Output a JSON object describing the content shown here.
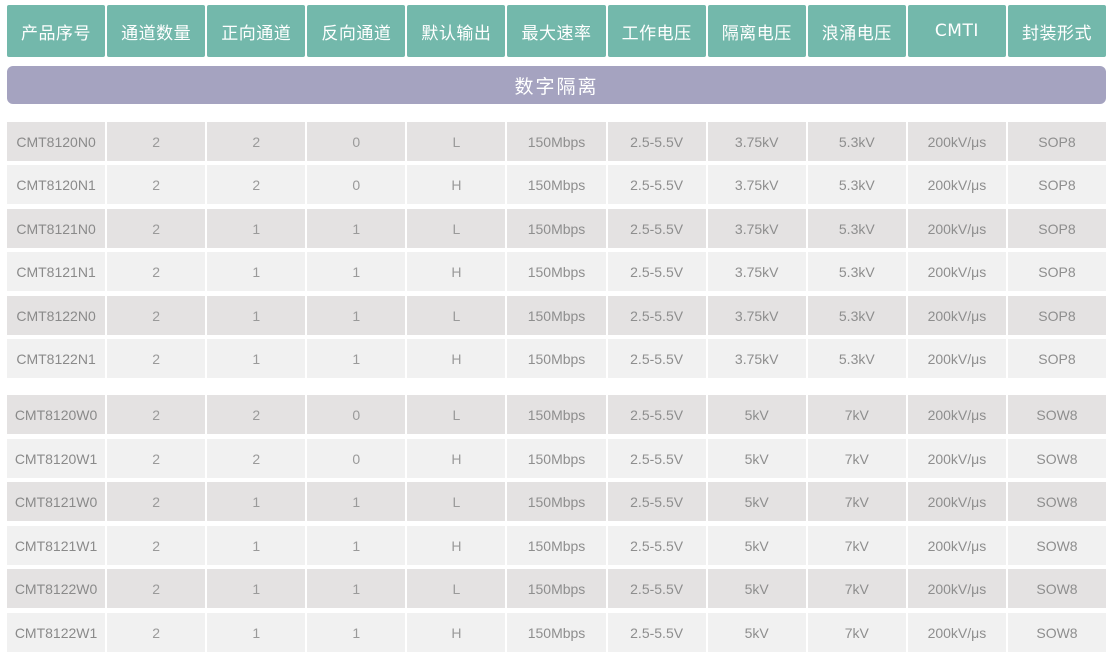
{
  "table": {
    "headers": [
      "产品序号",
      "通道数量",
      "正向通道",
      "反向通道",
      "默认输出",
      "最大速率",
      "工作电压",
      "隔离电压",
      "浪涌电压",
      "CMTI",
      "封装形式"
    ],
    "section_title": "数字隔离",
    "rows": [
      [
        "CMT8120N0",
        "2",
        "2",
        "0",
        "L",
        "150Mbps",
        "2.5-5.5V",
        "3.75kV",
        "5.3kV",
        "200kV/μs",
        "SOP8"
      ],
      [
        "CMT8120N1",
        "2",
        "2",
        "0",
        "H",
        "150Mbps",
        "2.5-5.5V",
        "3.75kV",
        "5.3kV",
        "200kV/μs",
        "SOP8"
      ],
      [
        "CMT8121N0",
        "2",
        "1",
        "1",
        "L",
        "150Mbps",
        "2.5-5.5V",
        "3.75kV",
        "5.3kV",
        "200kV/μs",
        "SOP8"
      ],
      [
        "CMT8121N1",
        "2",
        "1",
        "1",
        "H",
        "150Mbps",
        "2.5-5.5V",
        "3.75kV",
        "5.3kV",
        "200kV/μs",
        "SOP8"
      ],
      [
        "CMT8122N0",
        "2",
        "1",
        "1",
        "L",
        "150Mbps",
        "2.5-5.5V",
        "3.75kV",
        "5.3kV",
        "200kV/μs",
        "SOP8"
      ],
      [
        "CMT8122N1",
        "2",
        "1",
        "1",
        "H",
        "150Mbps",
        "2.5-5.5V",
        "3.75kV",
        "5.3kV",
        "200kV/μs",
        "SOP8"
      ],
      [
        "CMT8120W0",
        "2",
        "2",
        "0",
        "L",
        "150Mbps",
        "2.5-5.5V",
        "5kV",
        "7kV",
        "200kV/μs",
        "SOW8"
      ],
      [
        "CMT8120W1",
        "2",
        "2",
        "0",
        "H",
        "150Mbps",
        "2.5-5.5V",
        "5kV",
        "7kV",
        "200kV/μs",
        "SOW8"
      ],
      [
        "CMT8121W0",
        "2",
        "1",
        "1",
        "L",
        "150Mbps",
        "2.5-5.5V",
        "5kV",
        "7kV",
        "200kV/μs",
        "SOW8"
      ],
      [
        "CMT8121W1",
        "2",
        "1",
        "1",
        "H",
        "150Mbps",
        "2.5-5.5V",
        "5kV",
        "7kV",
        "200kV/μs",
        "SOW8"
      ],
      [
        "CMT8122W0",
        "2",
        "1",
        "1",
        "L",
        "150Mbps",
        "2.5-5.5V",
        "5kV",
        "7kV",
        "200kV/μs",
        "SOW8"
      ],
      [
        "CMT8122W1",
        "2",
        "1",
        "1",
        "H",
        "150Mbps",
        "2.5-5.5V",
        "5kV",
        "7kV",
        "200kV/μs",
        "SOW8"
      ]
    ]
  },
  "colors": {
    "header_bg": "#73b8ab",
    "section_bg": "#a5a3c0",
    "row_odd_bg": "#e4e2e2",
    "row_even_bg": "#f1f1f1",
    "cell_text": "#9a9a9a"
  }
}
